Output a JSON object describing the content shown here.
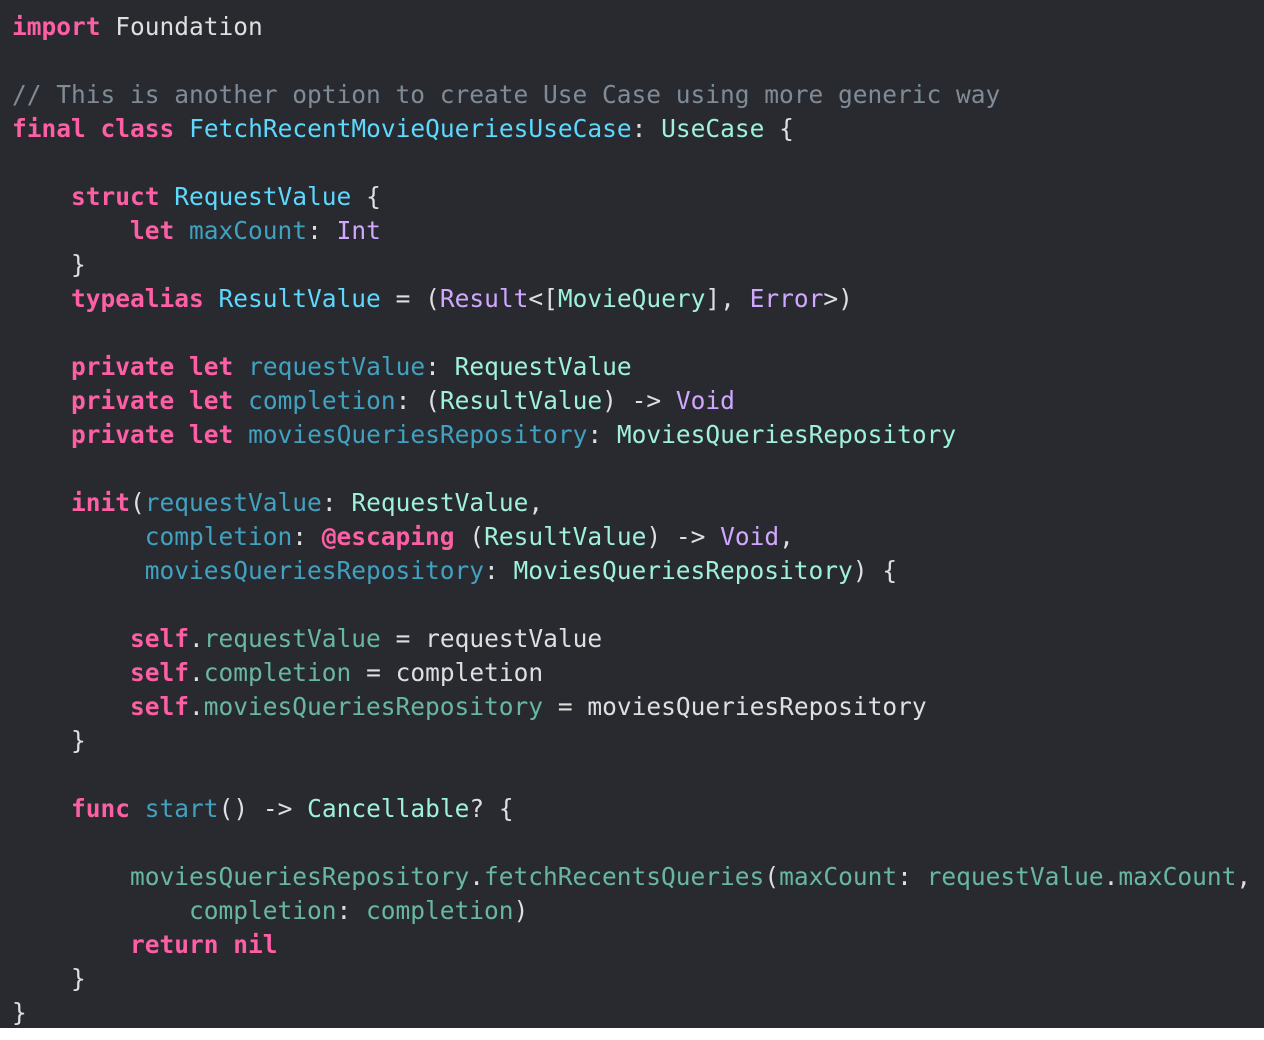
{
  "editor": {
    "language": "swift",
    "colors": {
      "background": "#292a30",
      "keyword": "#fc5fa3",
      "comment": "#7f8c98",
      "type-decl": "#5dd8ff",
      "type-proj": "#9ef1dd",
      "type-sys": "#d0a8ff",
      "ident-decl": "#41a1c0",
      "ident-proj": "#67b7a4",
      "plain": "#dfdfe0"
    },
    "lines": [
      {
        "tokens": [
          [
            "keyword",
            "import"
          ],
          [
            "plain",
            " Foundation"
          ]
        ]
      },
      {
        "tokens": []
      },
      {
        "tokens": [
          [
            "comment",
            "// This is another option to create Use Case using more generic way"
          ]
        ]
      },
      {
        "tokens": [
          [
            "keyword",
            "final"
          ],
          [
            "plain",
            " "
          ],
          [
            "keyword",
            "class"
          ],
          [
            "plain",
            " "
          ],
          [
            "type-decl",
            "FetchRecentMovieQueriesUseCase"
          ],
          [
            "plain",
            ": "
          ],
          [
            "type-proj",
            "UseCase"
          ],
          [
            "plain",
            " {"
          ]
        ]
      },
      {
        "tokens": []
      },
      {
        "tokens": [
          [
            "plain",
            "    "
          ],
          [
            "keyword",
            "struct"
          ],
          [
            "plain",
            " "
          ],
          [
            "type-decl",
            "RequestValue"
          ],
          [
            "plain",
            " {"
          ]
        ]
      },
      {
        "tokens": [
          [
            "plain",
            "        "
          ],
          [
            "keyword",
            "let"
          ],
          [
            "plain",
            " "
          ],
          [
            "ident-decl",
            "maxCount"
          ],
          [
            "plain",
            ": "
          ],
          [
            "type-sys",
            "Int"
          ]
        ]
      },
      {
        "tokens": [
          [
            "plain",
            "    }"
          ]
        ]
      },
      {
        "tokens": [
          [
            "plain",
            "    "
          ],
          [
            "keyword",
            "typealias"
          ],
          [
            "plain",
            " "
          ],
          [
            "type-decl",
            "ResultValue"
          ],
          [
            "plain",
            " = ("
          ],
          [
            "type-sys",
            "Result"
          ],
          [
            "plain",
            "<["
          ],
          [
            "type-proj",
            "MovieQuery"
          ],
          [
            "plain",
            "], "
          ],
          [
            "type-sys",
            "Error"
          ],
          [
            "plain",
            ">)"
          ]
        ]
      },
      {
        "tokens": []
      },
      {
        "tokens": [
          [
            "plain",
            "    "
          ],
          [
            "keyword",
            "private"
          ],
          [
            "plain",
            " "
          ],
          [
            "keyword",
            "let"
          ],
          [
            "plain",
            " "
          ],
          [
            "ident-decl",
            "requestValue"
          ],
          [
            "plain",
            ": "
          ],
          [
            "type-proj",
            "RequestValue"
          ]
        ]
      },
      {
        "tokens": [
          [
            "plain",
            "    "
          ],
          [
            "keyword",
            "private"
          ],
          [
            "plain",
            " "
          ],
          [
            "keyword",
            "let"
          ],
          [
            "plain",
            " "
          ],
          [
            "ident-decl",
            "completion"
          ],
          [
            "plain",
            ": ("
          ],
          [
            "type-proj",
            "ResultValue"
          ],
          [
            "plain",
            ") -> "
          ],
          [
            "type-sys",
            "Void"
          ]
        ]
      },
      {
        "tokens": [
          [
            "plain",
            "    "
          ],
          [
            "keyword",
            "private"
          ],
          [
            "plain",
            " "
          ],
          [
            "keyword",
            "let"
          ],
          [
            "plain",
            " "
          ],
          [
            "ident-decl",
            "moviesQueriesRepository"
          ],
          [
            "plain",
            ": "
          ],
          [
            "type-proj",
            "MoviesQueriesRepository"
          ]
        ]
      },
      {
        "tokens": []
      },
      {
        "tokens": [
          [
            "plain",
            "    "
          ],
          [
            "keyword",
            "init"
          ],
          [
            "plain",
            "("
          ],
          [
            "ident-decl",
            "requestValue"
          ],
          [
            "plain",
            ": "
          ],
          [
            "type-proj",
            "RequestValue"
          ],
          [
            "plain",
            ","
          ]
        ]
      },
      {
        "tokens": [
          [
            "plain",
            "         "
          ],
          [
            "ident-decl",
            "completion"
          ],
          [
            "plain",
            ": "
          ],
          [
            "keyword",
            "@escaping"
          ],
          [
            "plain",
            " ("
          ],
          [
            "type-proj",
            "ResultValue"
          ],
          [
            "plain",
            ") -> "
          ],
          [
            "type-sys",
            "Void"
          ],
          [
            "plain",
            ","
          ]
        ]
      },
      {
        "tokens": [
          [
            "plain",
            "         "
          ],
          [
            "ident-decl",
            "moviesQueriesRepository"
          ],
          [
            "plain",
            ": "
          ],
          [
            "type-proj",
            "MoviesQueriesRepository"
          ],
          [
            "plain",
            ") {"
          ]
        ]
      },
      {
        "tokens": []
      },
      {
        "tokens": [
          [
            "plain",
            "        "
          ],
          [
            "keyword",
            "self"
          ],
          [
            "plain",
            "."
          ],
          [
            "ident-proj",
            "requestValue"
          ],
          [
            "plain",
            " = requestValue"
          ]
        ]
      },
      {
        "tokens": [
          [
            "plain",
            "        "
          ],
          [
            "keyword",
            "self"
          ],
          [
            "plain",
            "."
          ],
          [
            "ident-proj",
            "completion"
          ],
          [
            "plain",
            " = completion"
          ]
        ]
      },
      {
        "tokens": [
          [
            "plain",
            "        "
          ],
          [
            "keyword",
            "self"
          ],
          [
            "plain",
            "."
          ],
          [
            "ident-proj",
            "moviesQueriesRepository"
          ],
          [
            "plain",
            " = moviesQueriesRepository"
          ]
        ]
      },
      {
        "tokens": [
          [
            "plain",
            "    }"
          ]
        ]
      },
      {
        "tokens": []
      },
      {
        "tokens": [
          [
            "plain",
            "    "
          ],
          [
            "keyword",
            "func"
          ],
          [
            "plain",
            " "
          ],
          [
            "ident-decl",
            "start"
          ],
          [
            "plain",
            "() -> "
          ],
          [
            "type-proj",
            "Cancellable"
          ],
          [
            "plain",
            "? {"
          ]
        ]
      },
      {
        "tokens": []
      },
      {
        "tokens": [
          [
            "plain",
            "        "
          ],
          [
            "ident-proj",
            "moviesQueriesRepository"
          ],
          [
            "plain",
            "."
          ],
          [
            "ident-proj",
            "fetchRecentsQueries"
          ],
          [
            "plain",
            "("
          ],
          [
            "ident-proj",
            "maxCount"
          ],
          [
            "plain",
            ": "
          ],
          [
            "ident-proj",
            "requestValue"
          ],
          [
            "plain",
            "."
          ],
          [
            "ident-proj",
            "maxCount"
          ],
          [
            "plain",
            ","
          ]
        ]
      },
      {
        "tokens": [
          [
            "plain",
            "            "
          ],
          [
            "ident-proj",
            "completion"
          ],
          [
            "plain",
            ": "
          ],
          [
            "ident-proj",
            "completion"
          ],
          [
            "plain",
            ")"
          ]
        ]
      },
      {
        "tokens": [
          [
            "plain",
            "        "
          ],
          [
            "keyword",
            "return"
          ],
          [
            "plain",
            " "
          ],
          [
            "keyword",
            "nil"
          ]
        ]
      },
      {
        "tokens": [
          [
            "plain",
            "    }"
          ]
        ]
      },
      {
        "tokens": [
          [
            "plain",
            "}"
          ]
        ]
      }
    ]
  }
}
